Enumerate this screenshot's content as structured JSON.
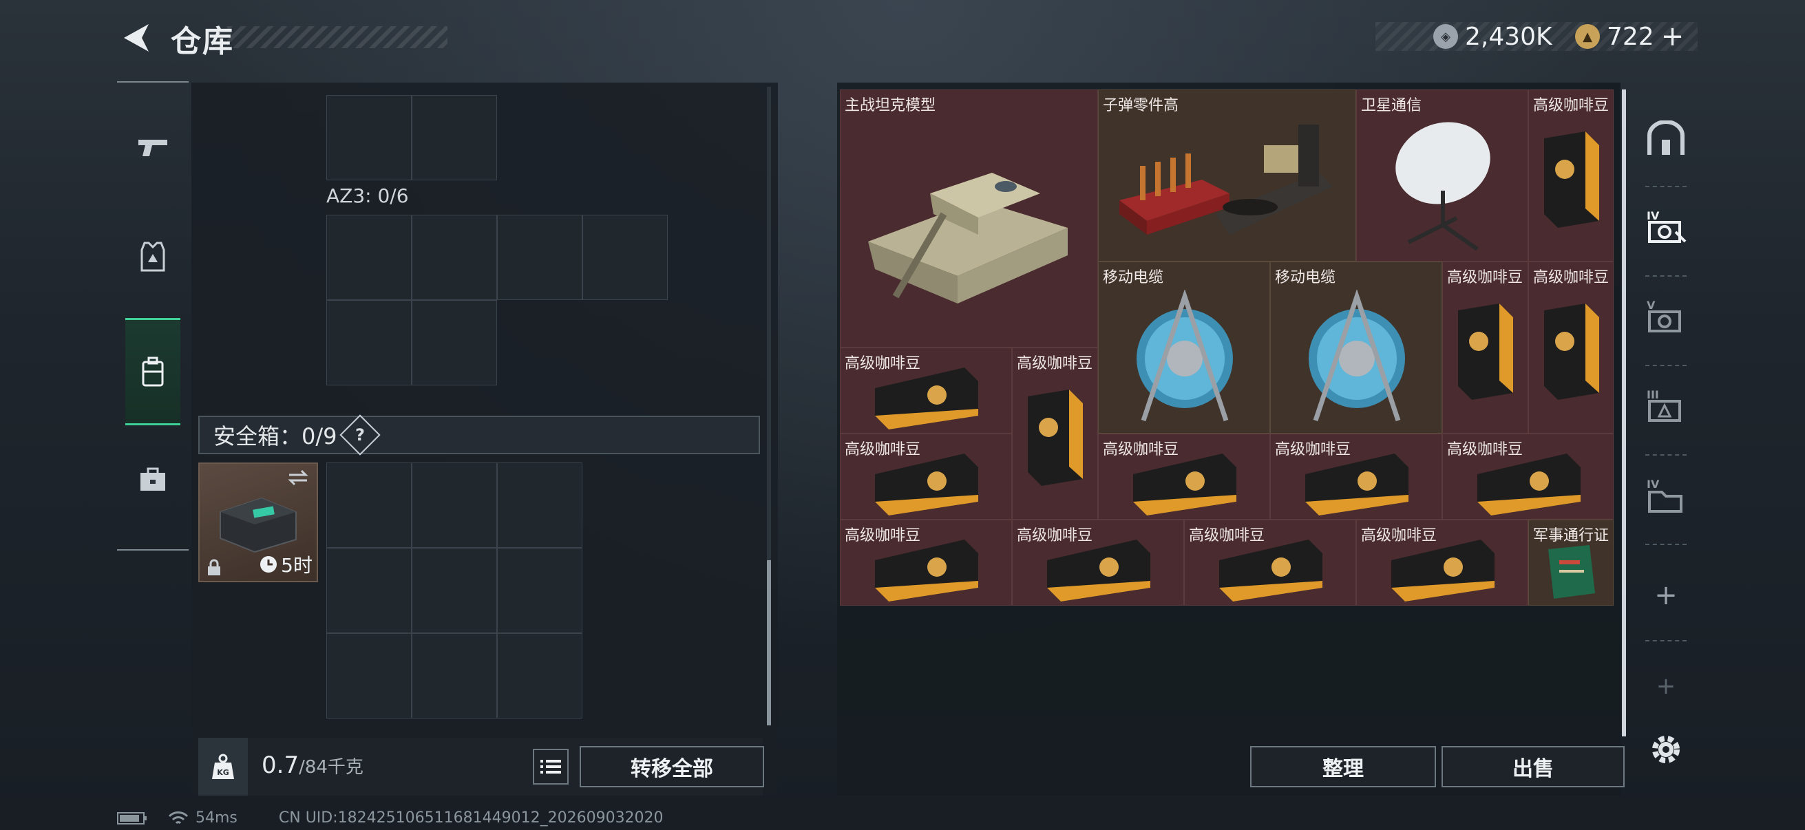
{
  "header": {
    "title": "仓库",
    "currencies": [
      {
        "icon": "silver-coin-icon",
        "value": "2,430K"
      },
      {
        "icon": "gold-coin-icon",
        "value": "722"
      }
    ],
    "add_label": "+"
  },
  "left_nav": {
    "items": [
      {
        "icon": "pistol-icon",
        "active": false
      },
      {
        "icon": "armor-icon",
        "active": false
      },
      {
        "icon": "backpack-icon",
        "active": true
      },
      {
        "icon": "briefcase-icon",
        "active": false
      }
    ]
  },
  "storage": {
    "az3_label": "AZ3: 0/6",
    "safebox_label": "安全箱：0/9",
    "help_label": "?",
    "safe_item": {
      "timer": "5时"
    }
  },
  "weight": {
    "current": "0.7",
    "max_unit": "/84千克"
  },
  "actions": {
    "transfer_all": "转移全部",
    "sort": "整理",
    "sell": "出售"
  },
  "inventory": {
    "items": [
      {
        "name": "主战坦克模型"
      },
      {
        "name": "子弹零件高"
      },
      {
        "name": "卫星通信"
      },
      {
        "name": "高级咖啡豆"
      },
      {
        "name": "移动电缆"
      },
      {
        "name": "移动电缆"
      },
      {
        "name": "高级咖啡豆"
      },
      {
        "name": "高级咖啡豆"
      },
      {
        "name": "高级咖啡豆"
      },
      {
        "name": "高级咖啡豆"
      },
      {
        "name": "高级咖啡豆"
      },
      {
        "name": "高级咖啡豆"
      },
      {
        "name": "高级咖啡豆"
      },
      {
        "name": "高级咖啡豆"
      },
      {
        "name": "高级咖啡豆"
      },
      {
        "name": "高级咖啡豆"
      },
      {
        "name": "高级咖啡豆"
      },
      {
        "name": "高级咖啡豆"
      },
      {
        "name": "高级咖啡豆"
      },
      {
        "name": "军事通行证"
      }
    ]
  },
  "right_nav": {
    "items": [
      {
        "icon": "shelter-icon"
      },
      {
        "icon": "storage-iv-icon"
      },
      {
        "icon": "storage-v-icon"
      },
      {
        "icon": "storage-iii-icon"
      },
      {
        "icon": "storage-iv-folder-icon"
      }
    ],
    "add_label": "+"
  },
  "status_bar": {
    "ping": "54ms",
    "uid": "CN UID:18242510651168144901​2_202609032020"
  },
  "colors": {
    "accent_green": "#3fd197",
    "item_red": "#4a2b2f",
    "item_brown": "#3f332a"
  }
}
